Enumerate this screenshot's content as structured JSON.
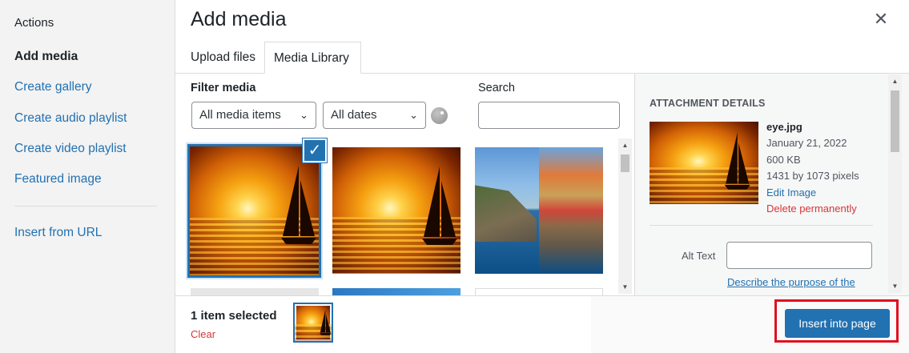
{
  "sidebar": {
    "heading": "Actions",
    "items": [
      {
        "label": "Add media",
        "active": true
      },
      {
        "label": "Create gallery"
      },
      {
        "label": "Create audio playlist"
      },
      {
        "label": "Create video playlist"
      },
      {
        "label": "Featured image"
      },
      {
        "label": "Insert from URL"
      }
    ]
  },
  "header": {
    "title": "Add media",
    "close_icon": "close-icon"
  },
  "tabs": [
    {
      "label": "Upload files"
    },
    {
      "label": "Media Library",
      "active": true
    }
  ],
  "toolbar": {
    "filter_label": "Filter media",
    "media_type": "All media items",
    "dates": "All dates",
    "search_label": "Search",
    "search_value": ""
  },
  "grid": {
    "items": [
      {
        "name": "sunset-sailboat",
        "selected": true
      },
      {
        "name": "sunset-sailboat-2",
        "selected": false
      },
      {
        "name": "coastal-village",
        "selected": false
      }
    ]
  },
  "details": {
    "heading": "ATTACHMENT DETAILS",
    "filename": "eye.jpg",
    "date": "January 21, 2022",
    "size": "600 KB",
    "dimensions": "1431 by 1073 pixels",
    "edit_link": "Edit Image",
    "delete_link": "Delete permanently",
    "alt_label": "Alt Text",
    "alt_value": "",
    "describe_link": "Describe the purpose of the"
  },
  "footer": {
    "selection_count": "1 item selected",
    "clear_label": "Clear",
    "insert_label": "Insert into page"
  },
  "colors": {
    "accent": "#2271b1",
    "danger": "#d63638",
    "highlight": "#e0101f"
  }
}
